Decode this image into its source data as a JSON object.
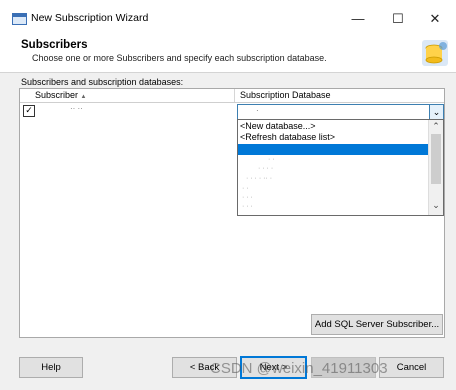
{
  "window": {
    "title": "New Subscription Wizard",
    "minimize": "—",
    "maximize": "☐",
    "close": "✕"
  },
  "header": {
    "title": "Subscribers",
    "subtitle": "Choose one or more Subscribers and specify each subscription database."
  },
  "grid": {
    "label": "Subscribers and subscription databases:",
    "columns": [
      "Subscriber",
      "Subscription Database"
    ],
    "sort_indicator": "▲",
    "row": {
      "checked": true,
      "check_glyph": "✓",
      "subscriber": "·· ··",
      "database": "·",
      "dropdown_arrow": "⌄"
    }
  },
  "dropdown": {
    "options": [
      "<New database...>",
      "<Refresh database list>",
      "",
      "· ·",
      "· ·  · ·",
      "· ·  · ·  ·· ·",
      "· ·",
      "· ·  ·",
      "·  · ·"
    ],
    "selected_index": 2,
    "scroll_up": "⌃",
    "scroll_down": "⌄"
  },
  "buttons": {
    "add_sql_server": "Add SQL Server Subscriber...",
    "help": "Help",
    "back": "< Back",
    "next": "Next >",
    "finish": "",
    "cancel": "Cancel"
  },
  "colors": {
    "selection": "#0078d7",
    "accent": "#3c7fb1"
  },
  "watermark": "CSDN @weixin_41911303"
}
